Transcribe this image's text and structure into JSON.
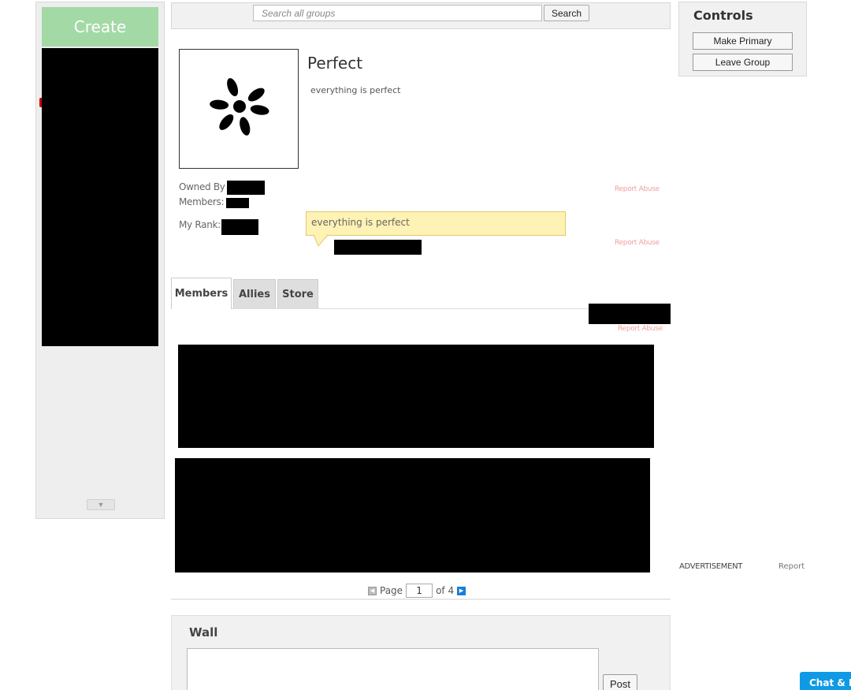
{
  "left_nav": {
    "create_label": "Create",
    "scroll_glyph": "▼"
  },
  "search": {
    "placeholder": "Search all groups",
    "button_label": "Search"
  },
  "group": {
    "name": "Perfect",
    "description": "everything is perfect",
    "emblem_icon": "asterisk-flower-icon",
    "owned_by_label": "Owned By",
    "members_label": "Members:",
    "my_rank_label": "My Rank:"
  },
  "report_abuse_label": "Report Abuse",
  "shout": {
    "text": "everything is perfect"
  },
  "tabs": [
    {
      "label": "Members",
      "active": true
    },
    {
      "label": "Allies",
      "active": false
    },
    {
      "label": "Store",
      "active": false
    }
  ],
  "pager": {
    "page_label": "Page",
    "current_page": "1",
    "of_label": "of 4"
  },
  "wall": {
    "title": "Wall",
    "post_label": "Post"
  },
  "controls": {
    "title": "Controls",
    "make_primary_label": "Make Primary",
    "leave_group_label": "Leave Group"
  },
  "advertisement": {
    "label": "ADVERTISEMENT",
    "report_label": "Report"
  },
  "chat": {
    "label": "Chat & P"
  },
  "colors": {
    "create_green": "#a3d9a5",
    "shout_yellow": "#fef2b5",
    "report_pink": "#f0a0a0",
    "chat_blue": "#0f9ae6"
  }
}
